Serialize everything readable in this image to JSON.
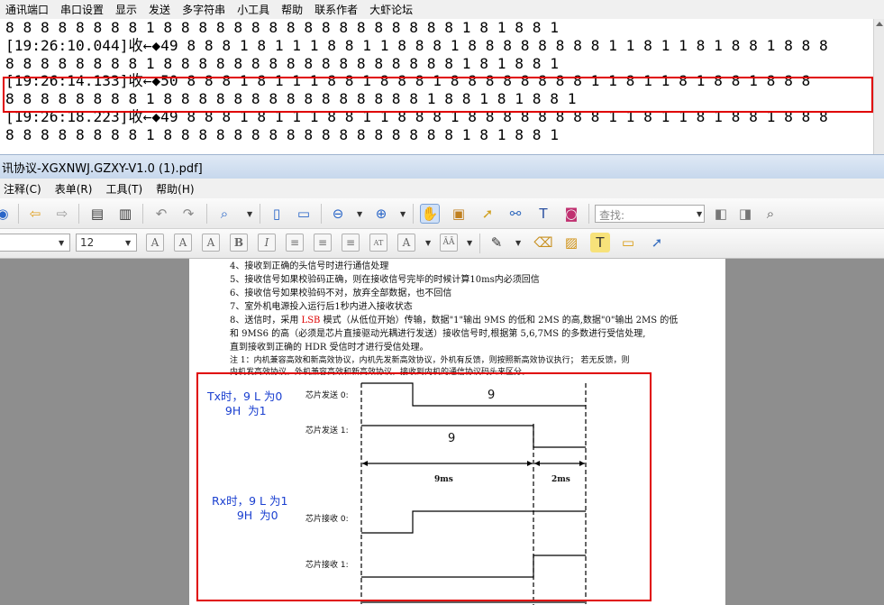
{
  "serial_tool": {
    "menu": [
      "通讯端口",
      "串口设置",
      "显示",
      "发送",
      "多字符串",
      "小工具",
      "帮助",
      "联系作者",
      "大虾论坛"
    ],
    "lines": [
      "8 8 8 8 8 8 8 8 1 8 8 8 8 8 8 8 8 8 8 8 8 8 8 8 8 8 1 8 1 8 8 1",
      "[19:26:10.044]收←◆49 8 8 8 1 8 1 1 1 8 8 1 1 8 8 8 1 8 8 8 8 8 8 8 8 1 1 8 1 1 8 1 8 8 1 8 8 8",
      "8 8 8 8 8 8 8 8 1 8 8 8 8 8 8 8 8 8 8 8 8 8 8 8 8 8 1 8 1 8 8 1",
      "[19:26:14.133]收←◆50 8 8 8 1 8 1 1 1 8 8 1 8 8 8 1 8 8 8 8 8 8 8 8 1 1 8 1 1 8 1 8 8 1 8 8 8",
      "8 8 8 8 8 8 8 8 1 8 8 8 8 8 8 8 8 8 8 8 8 8 8 8 1 8 8 1 8 1 8 8 1",
      "[19:26:18.223]收←◆49 8 8 8 1 8 1 1 1 8 8 1 1 8 8 8 1 8 8 8 8 8 8 8 8 1 1 8 1 1 8 1 8 8 1 8 8 8",
      "8 8 8 8 8 8 8 8 1 8 8 8 8 8 8 8 8 8 8 8 8 8 8 8 8 8 1 8 1 8 8 1"
    ]
  },
  "pdf_window": {
    "title": "讯协议-XGXNWJ.GZXY-V1.0 (1).pdf]",
    "menu": [
      "注释(C)",
      "表单(R)",
      "工具(T)",
      "帮助(H)"
    ],
    "search_placeholder": "查找:",
    "font_size": "12",
    "page_lines": [
      "4、接收到正确的头信号时进行通信处理",
      "5、接收信号如果校验码正确，则在接收信号完毕的时候计算10ms内必须回信",
      "6、接收信号如果校验码不对，放弃全部数据，也不回信",
      "7、室外机电源投入运行后1秒内进入接收状态"
    ],
    "item8": {
      "prefix": "8、送信时，采用 ",
      "lsb": "LSB",
      "rest": " 模式（从低位开始）传输，数据\"1\"输出 9MS 的低和 2MS 的高,数据\"0\"输出 2MS 的低",
      "line2": "和 9MS6 的高（必须是芯片直接驱动光耦进行发送）接收信号时,根据第 5,6,7MS 的多数进行受信处理,",
      "line3": "直到接收到正确的 HDR 受信时才进行受信处理。"
    },
    "note_line1": "注 1：内机兼容高效和新高效协议，内机先发新高效协议，外机有反馈，则按照新高效协议执行； 若无反馈，则",
    "note_line2": "内机发高效协议，外机兼容高效和新高效协议，接收到内机的通信协议码头来区分。",
    "timing": {
      "tx_note": "Tx时，9 L 为0\n     9H  为1",
      "rx_note": "Rx时，9 L 为1\n       9H  为0",
      "chip_send_0": "芯片发送 0:",
      "chip_send_1": "芯片发送 1:",
      "chip_recv_0": "芯片接收 0:",
      "chip_recv_1": "芯片接收 1:",
      "nine_a": "9",
      "nine_b": "9",
      "dur_9ms": "9ms",
      "dur_2ms": "2ms"
    }
  }
}
